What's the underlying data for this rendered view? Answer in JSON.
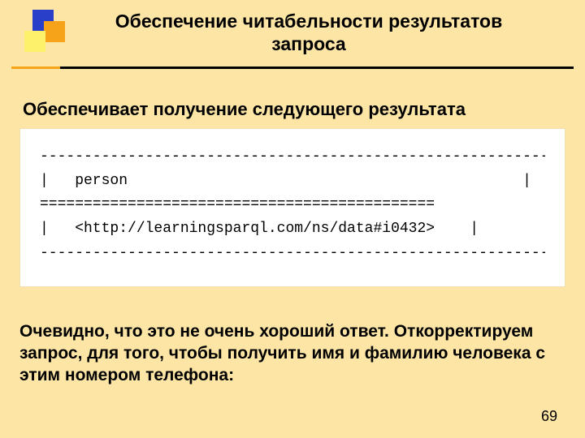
{
  "title": "Обеспечение читабельности результатов запроса",
  "lead": "Обеспечивает получение следующего результата",
  "result": {
    "dash_line": "-----------------------------------------------------------------------------",
    "header_row": "|   person                                             |",
    "eq_line": "=============================================",
    "data_row": "|   <http://learningsparql.com/ns/data#i0432>    |",
    "dash_line2": "-----------------------------------------------------------------------------"
  },
  "explanation": "Очевидно, что это не очень хороший ответ. Откорректируем  запрос, для того, чтобы получить имя и фамилию человека с этим номером телефона:",
  "page_number": "69"
}
